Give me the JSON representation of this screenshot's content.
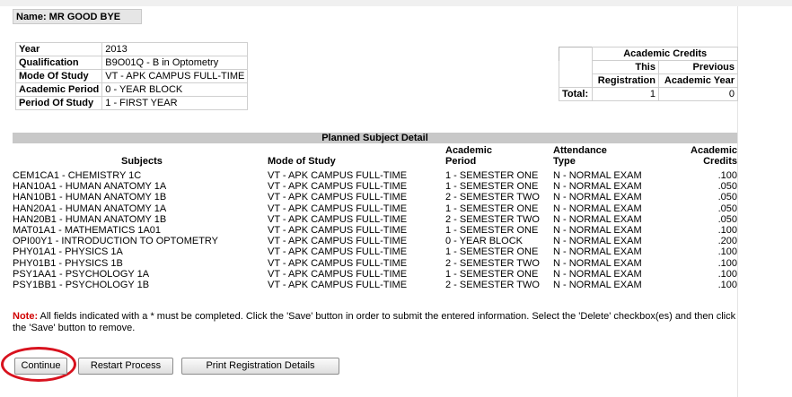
{
  "name_label": "Name: MR GOOD BYE",
  "student_info": [
    {
      "label": "Year",
      "value": "2013"
    },
    {
      "label": "Qualification",
      "value": "B9O01Q - B in Optometry"
    },
    {
      "label": "Mode Of Study",
      "value": "VT - APK CAMPUS FULL-TIME"
    },
    {
      "label": "Academic Period",
      "value": "0 - YEAR BLOCK"
    },
    {
      "label": "Period Of Study",
      "value": "1 - FIRST YEAR"
    }
  ],
  "credits": {
    "title": "Academic Credits",
    "this_registration_line1": "This",
    "this_registration_line2": "Registration",
    "previous_line1": "Previous",
    "previous_line2": "Academic Year",
    "total_label": "Total:",
    "total_this": "1",
    "total_previous": "0"
  },
  "planned": {
    "title": "Planned Subject Detail",
    "headers": {
      "subjects": "Subjects",
      "mode": "Mode of Study",
      "period_line1": "Academic",
      "period_line2": "Period",
      "attendance_line1": "Attendance",
      "attendance_line2": "Type",
      "credits_line1": "Academic",
      "credits_line2": "Credits"
    },
    "rows": [
      {
        "subject": "CEM1CA1 - CHEMISTRY 1C",
        "mode": "VT - APK CAMPUS FULL-TIME",
        "period": "1 - SEMESTER ONE",
        "attendance": "N - NORMAL EXAM",
        "credits": ".100"
      },
      {
        "subject": "HAN10A1 - HUMAN ANATOMY 1A",
        "mode": "VT - APK CAMPUS FULL-TIME",
        "period": "1 - SEMESTER ONE",
        "attendance": "N - NORMAL EXAM",
        "credits": ".050"
      },
      {
        "subject": "HAN10B1 - HUMAN ANATOMY 1B",
        "mode": "VT - APK CAMPUS FULL-TIME",
        "period": "2 - SEMESTER TWO",
        "attendance": "N - NORMAL EXAM",
        "credits": ".050"
      },
      {
        "subject": "HAN20A1 - HUMAN ANATOMY 1A",
        "mode": "VT - APK CAMPUS FULL-TIME",
        "period": "1 - SEMESTER ONE",
        "attendance": "N - NORMAL EXAM",
        "credits": ".050"
      },
      {
        "subject": "HAN20B1 - HUMAN ANATOMY 1B",
        "mode": "VT - APK CAMPUS FULL-TIME",
        "period": "2 - SEMESTER TWO",
        "attendance": "N - NORMAL EXAM",
        "credits": ".050"
      },
      {
        "subject": "MAT01A1 - MATHEMATICS 1A01",
        "mode": "VT - APK CAMPUS FULL-TIME",
        "period": "1 - SEMESTER ONE",
        "attendance": "N - NORMAL EXAM",
        "credits": ".100"
      },
      {
        "subject": "OPI00Y1 - INTRODUCTION TO OPTOMETRY",
        "mode": "VT - APK CAMPUS FULL-TIME",
        "period": "0 - YEAR BLOCK",
        "attendance": "N - NORMAL EXAM",
        "credits": ".200"
      },
      {
        "subject": "PHY01A1 - PHYSICS 1A",
        "mode": "VT - APK CAMPUS FULL-TIME",
        "period": "1 - SEMESTER ONE",
        "attendance": "N - NORMAL EXAM",
        "credits": ".100"
      },
      {
        "subject": "PHY01B1 - PHYSICS 1B",
        "mode": "VT - APK CAMPUS FULL-TIME",
        "period": "2 - SEMESTER TWO",
        "attendance": "N - NORMAL EXAM",
        "credits": ".100"
      },
      {
        "subject": "PSY1AA1 - PSYCHOLOGY 1A",
        "mode": "VT - APK CAMPUS FULL-TIME",
        "period": "1 - SEMESTER ONE",
        "attendance": "N - NORMAL EXAM",
        "credits": ".100"
      },
      {
        "subject": "PSY1BB1 - PSYCHOLOGY 1B",
        "mode": "VT - APK CAMPUS FULL-TIME",
        "period": "2 - SEMESTER TWO",
        "attendance": "N - NORMAL EXAM",
        "credits": ".100"
      }
    ]
  },
  "note": {
    "prefix": "Note:",
    "text": " All fields indicated with a * must be completed. Click the 'Save' button in order to submit the entered information. Select the 'Delete' checkbox(es) and then click the 'Save' button to remove."
  },
  "buttons": {
    "continue": "Continue",
    "restart": "Restart Process",
    "print": "Print Registration Details"
  },
  "colors": {
    "highlight_ring": "#d8121e",
    "note_prefix": "#d00000",
    "section_header_bg": "#c8c8c8"
  }
}
